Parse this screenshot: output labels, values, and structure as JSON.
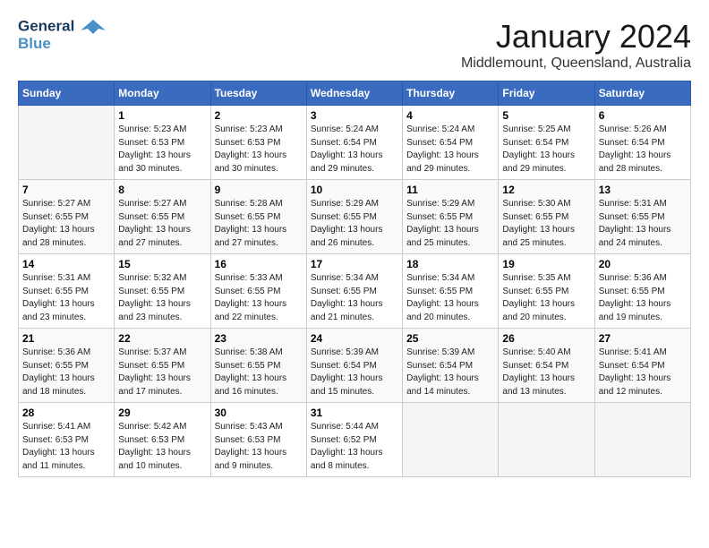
{
  "header": {
    "logo_line1": "General",
    "logo_line2": "Blue",
    "month": "January 2024",
    "location": "Middlemount, Queensland, Australia"
  },
  "weekdays": [
    "Sunday",
    "Monday",
    "Tuesday",
    "Wednesday",
    "Thursday",
    "Friday",
    "Saturday"
  ],
  "weeks": [
    [
      {
        "day": "",
        "sunrise": "",
        "sunset": "",
        "daylight": ""
      },
      {
        "day": "1",
        "sunrise": "Sunrise: 5:23 AM",
        "sunset": "Sunset: 6:53 PM",
        "daylight": "Daylight: 13 hours and 30 minutes."
      },
      {
        "day": "2",
        "sunrise": "Sunrise: 5:23 AM",
        "sunset": "Sunset: 6:53 PM",
        "daylight": "Daylight: 13 hours and 30 minutes."
      },
      {
        "day": "3",
        "sunrise": "Sunrise: 5:24 AM",
        "sunset": "Sunset: 6:54 PM",
        "daylight": "Daylight: 13 hours and 29 minutes."
      },
      {
        "day": "4",
        "sunrise": "Sunrise: 5:24 AM",
        "sunset": "Sunset: 6:54 PM",
        "daylight": "Daylight: 13 hours and 29 minutes."
      },
      {
        "day": "5",
        "sunrise": "Sunrise: 5:25 AM",
        "sunset": "Sunset: 6:54 PM",
        "daylight": "Daylight: 13 hours and 29 minutes."
      },
      {
        "day": "6",
        "sunrise": "Sunrise: 5:26 AM",
        "sunset": "Sunset: 6:54 PM",
        "daylight": "Daylight: 13 hours and 28 minutes."
      }
    ],
    [
      {
        "day": "7",
        "sunrise": "Sunrise: 5:27 AM",
        "sunset": "Sunset: 6:55 PM",
        "daylight": "Daylight: 13 hours and 28 minutes."
      },
      {
        "day": "8",
        "sunrise": "Sunrise: 5:27 AM",
        "sunset": "Sunset: 6:55 PM",
        "daylight": "Daylight: 13 hours and 27 minutes."
      },
      {
        "day": "9",
        "sunrise": "Sunrise: 5:28 AM",
        "sunset": "Sunset: 6:55 PM",
        "daylight": "Daylight: 13 hours and 27 minutes."
      },
      {
        "day": "10",
        "sunrise": "Sunrise: 5:29 AM",
        "sunset": "Sunset: 6:55 PM",
        "daylight": "Daylight: 13 hours and 26 minutes."
      },
      {
        "day": "11",
        "sunrise": "Sunrise: 5:29 AM",
        "sunset": "Sunset: 6:55 PM",
        "daylight": "Daylight: 13 hours and 25 minutes."
      },
      {
        "day": "12",
        "sunrise": "Sunrise: 5:30 AM",
        "sunset": "Sunset: 6:55 PM",
        "daylight": "Daylight: 13 hours and 25 minutes."
      },
      {
        "day": "13",
        "sunrise": "Sunrise: 5:31 AM",
        "sunset": "Sunset: 6:55 PM",
        "daylight": "Daylight: 13 hours and 24 minutes."
      }
    ],
    [
      {
        "day": "14",
        "sunrise": "Sunrise: 5:31 AM",
        "sunset": "Sunset: 6:55 PM",
        "daylight": "Daylight: 13 hours and 23 minutes."
      },
      {
        "day": "15",
        "sunrise": "Sunrise: 5:32 AM",
        "sunset": "Sunset: 6:55 PM",
        "daylight": "Daylight: 13 hours and 23 minutes."
      },
      {
        "day": "16",
        "sunrise": "Sunrise: 5:33 AM",
        "sunset": "Sunset: 6:55 PM",
        "daylight": "Daylight: 13 hours and 22 minutes."
      },
      {
        "day": "17",
        "sunrise": "Sunrise: 5:34 AM",
        "sunset": "Sunset: 6:55 PM",
        "daylight": "Daylight: 13 hours and 21 minutes."
      },
      {
        "day": "18",
        "sunrise": "Sunrise: 5:34 AM",
        "sunset": "Sunset: 6:55 PM",
        "daylight": "Daylight: 13 hours and 20 minutes."
      },
      {
        "day": "19",
        "sunrise": "Sunrise: 5:35 AM",
        "sunset": "Sunset: 6:55 PM",
        "daylight": "Daylight: 13 hours and 20 minutes."
      },
      {
        "day": "20",
        "sunrise": "Sunrise: 5:36 AM",
        "sunset": "Sunset: 6:55 PM",
        "daylight": "Daylight: 13 hours and 19 minutes."
      }
    ],
    [
      {
        "day": "21",
        "sunrise": "Sunrise: 5:36 AM",
        "sunset": "Sunset: 6:55 PM",
        "daylight": "Daylight: 13 hours and 18 minutes."
      },
      {
        "day": "22",
        "sunrise": "Sunrise: 5:37 AM",
        "sunset": "Sunset: 6:55 PM",
        "daylight": "Daylight: 13 hours and 17 minutes."
      },
      {
        "day": "23",
        "sunrise": "Sunrise: 5:38 AM",
        "sunset": "Sunset: 6:55 PM",
        "daylight": "Daylight: 13 hours and 16 minutes."
      },
      {
        "day": "24",
        "sunrise": "Sunrise: 5:39 AM",
        "sunset": "Sunset: 6:54 PM",
        "daylight": "Daylight: 13 hours and 15 minutes."
      },
      {
        "day": "25",
        "sunrise": "Sunrise: 5:39 AM",
        "sunset": "Sunset: 6:54 PM",
        "daylight": "Daylight: 13 hours and 14 minutes."
      },
      {
        "day": "26",
        "sunrise": "Sunrise: 5:40 AM",
        "sunset": "Sunset: 6:54 PM",
        "daylight": "Daylight: 13 hours and 13 minutes."
      },
      {
        "day": "27",
        "sunrise": "Sunrise: 5:41 AM",
        "sunset": "Sunset: 6:54 PM",
        "daylight": "Daylight: 13 hours and 12 minutes."
      }
    ],
    [
      {
        "day": "28",
        "sunrise": "Sunrise: 5:41 AM",
        "sunset": "Sunset: 6:53 PM",
        "daylight": "Daylight: 13 hours and 11 minutes."
      },
      {
        "day": "29",
        "sunrise": "Sunrise: 5:42 AM",
        "sunset": "Sunset: 6:53 PM",
        "daylight": "Daylight: 13 hours and 10 minutes."
      },
      {
        "day": "30",
        "sunrise": "Sunrise: 5:43 AM",
        "sunset": "Sunset: 6:53 PM",
        "daylight": "Daylight: 13 hours and 9 minutes."
      },
      {
        "day": "31",
        "sunrise": "Sunrise: 5:44 AM",
        "sunset": "Sunset: 6:52 PM",
        "daylight": "Daylight: 13 hours and 8 minutes."
      },
      {
        "day": "",
        "sunrise": "",
        "sunset": "",
        "daylight": ""
      },
      {
        "day": "",
        "sunrise": "",
        "sunset": "",
        "daylight": ""
      },
      {
        "day": "",
        "sunrise": "",
        "sunset": "",
        "daylight": ""
      }
    ]
  ]
}
